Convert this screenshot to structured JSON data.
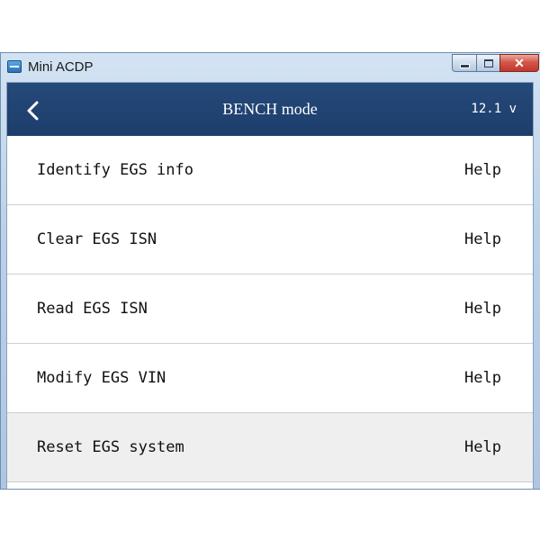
{
  "window": {
    "title": "Mini ACDP",
    "icon": "app-icon",
    "close_glyph": "✕"
  },
  "header": {
    "back_icon": "chevron-left-icon",
    "title": "BENCH mode",
    "voltage": "12.1 v"
  },
  "menu": {
    "items": [
      {
        "label": "Identify EGS info",
        "help": "Help"
      },
      {
        "label": "Clear EGS ISN",
        "help": "Help"
      },
      {
        "label": "Read EGS ISN",
        "help": "Help"
      },
      {
        "label": "Modify EGS VIN",
        "help": "Help"
      },
      {
        "label": "Reset EGS system",
        "help": "Help"
      }
    ]
  },
  "colors": {
    "header_bg": "#1d3e6b",
    "active_row_bg": "#efefef",
    "divider": "#cfcfcf"
  }
}
